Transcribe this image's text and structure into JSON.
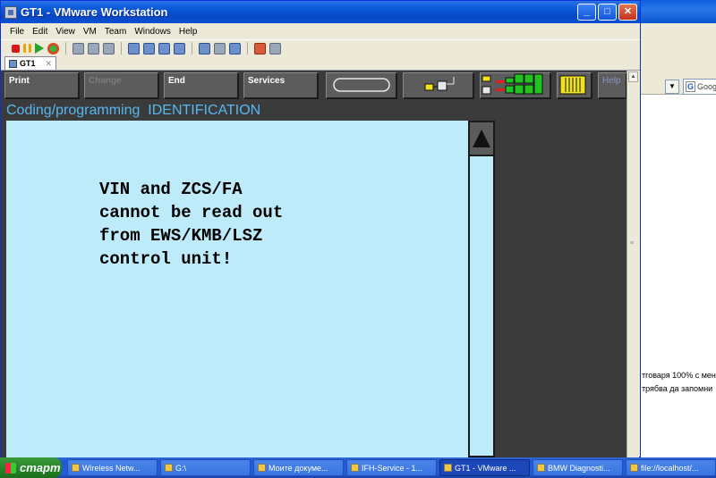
{
  "vmware": {
    "title": "GT1 - VMware Workstation",
    "menu": [
      "File",
      "Edit",
      "View",
      "VM",
      "Team",
      "Windows",
      "Help"
    ],
    "tab_label": "GT1",
    "tab_close": "✕",
    "window_buttons": {
      "minimize": "_",
      "maximize": "□",
      "close": "✕"
    }
  },
  "guest": {
    "buttons": {
      "print": "Print",
      "change": "Change",
      "end": "End",
      "services": "Services",
      "help": "Help"
    },
    "heading": "Coding/programming  IDENTIFICATION",
    "message": "VIN and ZCS/FA\ncannot be read out\nfrom EWS/KMB/LSZ\ncontrol unit!",
    "colors": {
      "background": "#3b3b3b",
      "content": "#bdebfa",
      "heading": "#56b8f0",
      "status_green": "#1fc41f",
      "status_red": "#e02020",
      "status_yellow": "#f2e21c"
    }
  },
  "browser_bg": {
    "search_label": "Goog",
    "text_line1": "тговаря 100% с мен",
    "text_line2": "трябва да запомни"
  },
  "taskbar": {
    "start_label": "старт",
    "items": [
      {
        "label": "Wireless Netw...",
        "active": false
      },
      {
        "label": "G:\\",
        "active": false
      },
      {
        "label": "Моите докуме...",
        "active": false
      },
      {
        "label": "IFH-Service - 1...",
        "active": false
      },
      {
        "label": "GT1 - VMware ...",
        "active": true
      },
      {
        "label": "BMW Diagnosti...",
        "active": false
      },
      {
        "label": "file://localhost/...",
        "active": false
      }
    ]
  }
}
